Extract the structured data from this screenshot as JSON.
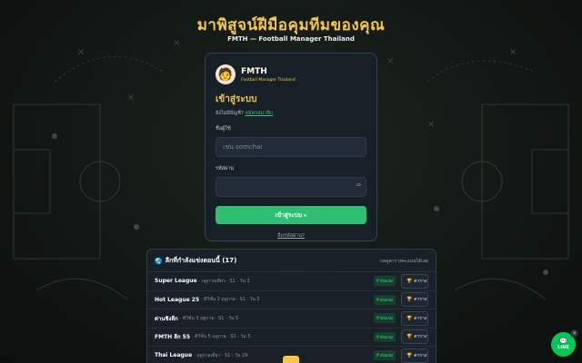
{
  "hero": {
    "title": "มาพิสูจน์ฝีมือคุมทีมของคุณ",
    "subtitle": "FMTH — Football Manager Thailand"
  },
  "login_card": {
    "brand_logo": "manager-avatar-icon",
    "brand_name": "FMTH",
    "brand_tagline": "Football Manager Thailand",
    "title": "เข้าสู่ระบบ",
    "no_account_text": "ยังไม่มีบัญชี?",
    "register_link": "สมัครสมาชิก",
    "username_label": "ชื่อผู้ใช้",
    "username_placeholder": "เช่น somchai",
    "username_value": "",
    "password_label": "รหัสผ่าน",
    "password_value": "",
    "submit_label": "เข้าสู่ระบบ ▸",
    "forgot_label": "ลืมรหัสผ่าน?"
  },
  "leagues": {
    "title": "ลีกที่กำลังแข่งตอนนี้ (17)",
    "header_right": "กดดูตารางคะแนนได้เลย",
    "status_label": "กำลังแข่ง",
    "table_button_label": "ตาราง",
    "items": [
      {
        "name": "Super League",
        "meta": "· ฤดูกาลเดียว · S1 · วัน 3"
      },
      {
        "name": "Hot League 25",
        "meta": "· ดิวิชั่น 2 ฤดูกาล · S1 · วัน 5"
      },
      {
        "name": "ด่านชิงลีก",
        "meta": "· ดิวิชั่น 3 ฤดูกาล · S1 · วัน 5"
      },
      {
        "name": "FMTH ลีก 55",
        "meta": "· ดิวิชั่น 5 ฤดูกาล · S1 · วัน 5"
      },
      {
        "name": "Thai League",
        "meta": "· ฤดูกาลเดียว · S1 · วัน 29"
      }
    ]
  },
  "line_chat": {
    "label": "LINE",
    "icon": "chat-bubble-icon",
    "close": "×"
  },
  "colors": {
    "accent_gold": "#f4c84a",
    "accent_green": "#2fbf74",
    "line_green": "#06c755"
  }
}
